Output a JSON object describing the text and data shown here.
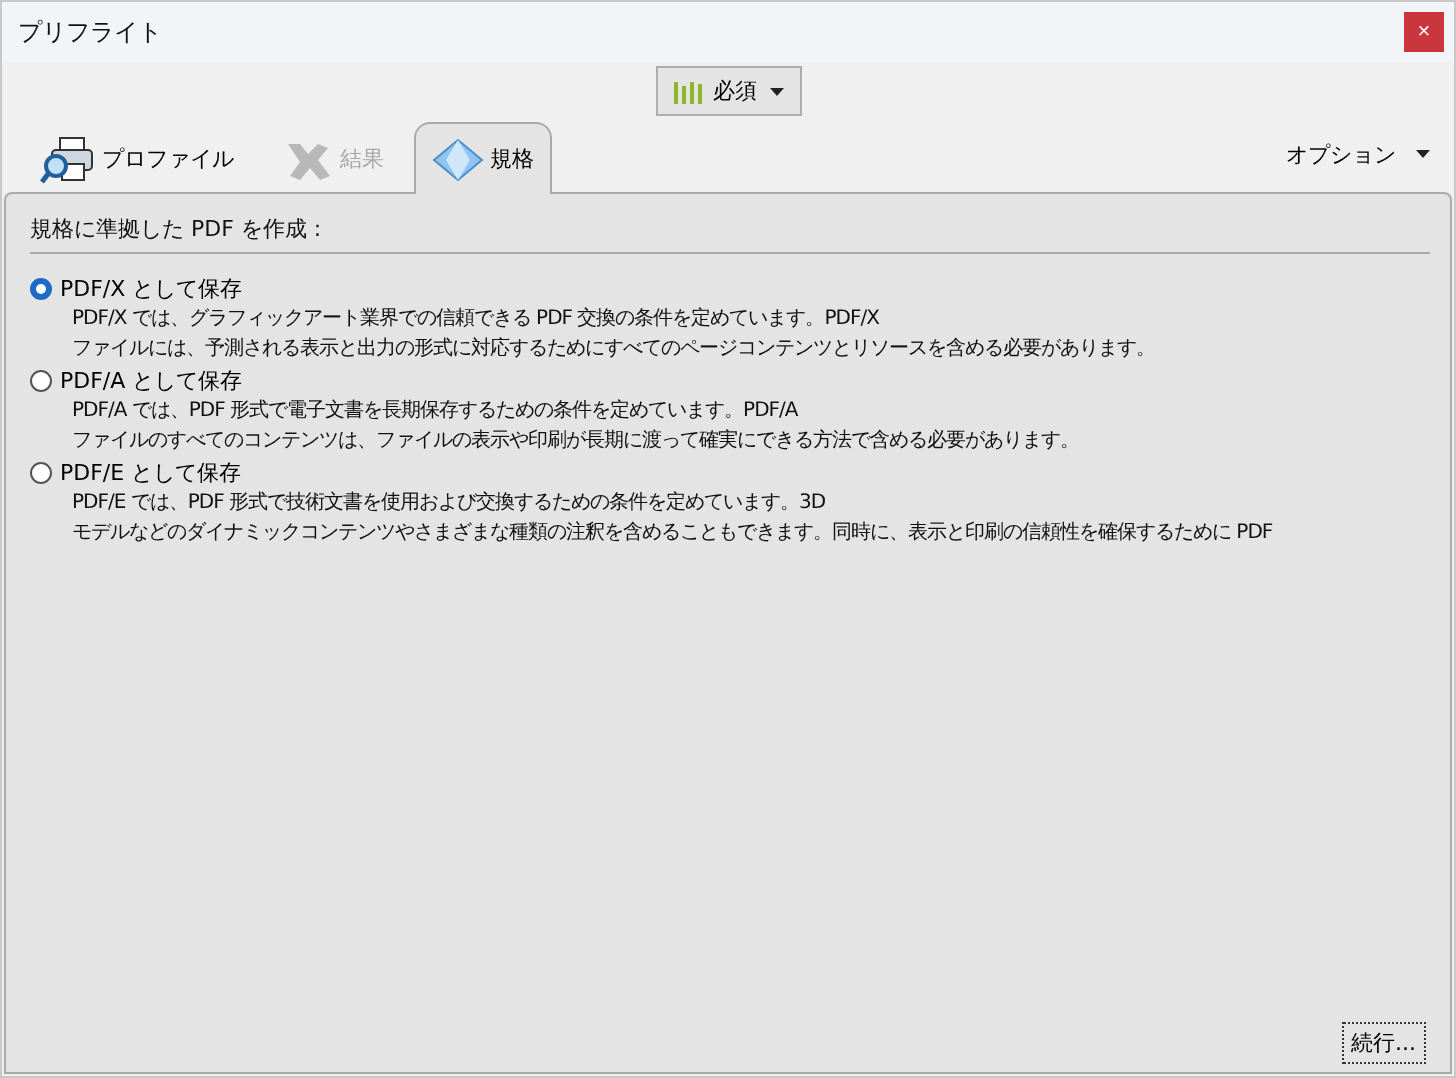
{
  "window": {
    "title": "プリフライト",
    "close": "×"
  },
  "filter_button": {
    "label": "必須"
  },
  "tabs": [
    {
      "label": "プロファイル",
      "kind": "profile",
      "selected": false,
      "disabled": false
    },
    {
      "label": "結果",
      "kind": "results",
      "selected": false,
      "disabled": true
    },
    {
      "label": "規格",
      "kind": "standards",
      "selected": true,
      "disabled": false
    }
  ],
  "options_menu": {
    "label": "オプション"
  },
  "panel": {
    "heading": "規格に準拠した PDF を作成 :",
    "choices": [
      {
        "label": "PDF/X として保存",
        "selected": true,
        "description_lines": [
          "PDF/X では、グラフィックアート業界での信頼できる PDF 交換の条件を定めています。PDF/X",
          "ファイルには、予測される表示と出力の形式に対応するためにすべてのページコンテンツとリソースを含める必要があります。"
        ]
      },
      {
        "label": "PDF/A として保存",
        "selected": false,
        "description_lines": [
          "PDF/A では、PDF 形式で電子文書を長期保存するための条件を定めています。PDF/A",
          "ファイルのすべてのコンテンツは、ファイルの表示や印刷が長期に渡って確実にできる方法で含める必要があります。"
        ]
      },
      {
        "label": "PDF/E として保存",
        "selected": false,
        "description_lines": [
          "PDF/E では、PDF 形式で技術文書を使用および交換するための条件を定めています。3D",
          "モデルなどのダイナミックコンテンツやさまざまな種類の注釈を含めることもできます。同時に、表示と印刷の信頼性を確保するために PDF"
        ]
      }
    ]
  },
  "continue_button": {
    "label": "続行..."
  }
}
